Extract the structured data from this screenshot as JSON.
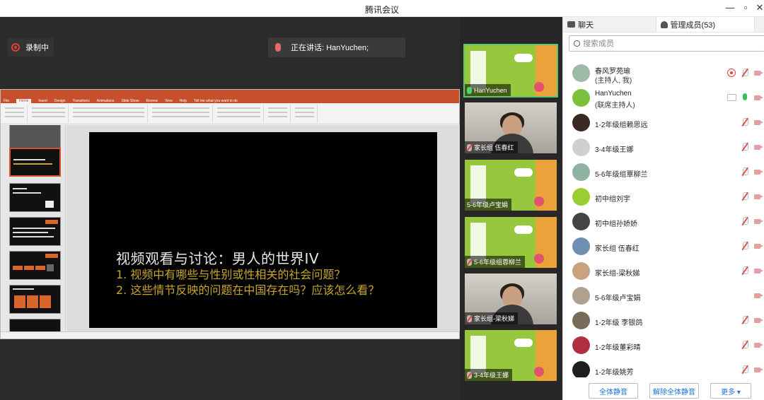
{
  "window": {
    "title": "腾讯会议",
    "controls": [
      "—",
      "▫",
      "✕"
    ]
  },
  "stage": {
    "recording_label": "录制中",
    "speaking_label": "正在讲话: HanYuchen;"
  },
  "slide": {
    "title": "视频观看与讨论：男人的世界IV",
    "lines": [
      "1. 视频中有哪些与性别或性相关的社会问题？",
      "2. 这些情节反映的问题在中国存在吗？应该怎么看？"
    ]
  },
  "ppt": {
    "tabs": [
      "File",
      "Home",
      "Insert",
      "Design",
      "Transitions",
      "Animations",
      "Slide Show",
      "Review",
      "View",
      "Help",
      "Tell me what you want to do"
    ],
    "share": "Share"
  },
  "tiles": [
    {
      "name": "HanYuchen",
      "type": "poster",
      "mic": "on",
      "active": true
    },
    {
      "name": "家长组 伍春红",
      "type": "cam",
      "mic": "off"
    },
    {
      "name": "5-6年级卢宝娟",
      "type": "poster",
      "mic": "none"
    },
    {
      "name": "5-6年级组蓉柳兰",
      "type": "poster",
      "mic": "off"
    },
    {
      "name": "家长组-梁秋娣",
      "type": "cam",
      "mic": "off"
    },
    {
      "name": "3-4年级王娜",
      "type": "poster",
      "mic": "off"
    }
  ],
  "panel": {
    "tab_chat": "聊天",
    "tab_members": "管理成员(53)",
    "search_placeholder": "搜索成员",
    "members": [
      {
        "name": "春风罗苑瑜",
        "sub": "(主持人, 我)",
        "color": "#9db9a8",
        "icons": [
          "rec",
          "micoff",
          "camoff"
        ]
      },
      {
        "name": "HanYuchen",
        "sub": "(联席主持人)",
        "color": "#7cbf3a",
        "icons": [
          "screen",
          "micon",
          "camoff"
        ]
      },
      {
        "name": "1-2年级组赖思远",
        "color": "#3a2a22",
        "icons": [
          "micoff",
          "camoff"
        ]
      },
      {
        "name": "3-4年级王娜",
        "color": "#cfcfcf",
        "icons": [
          "micoff",
          "camoff"
        ]
      },
      {
        "name": "5-6年级组覃柳兰",
        "color": "#8fb3a0",
        "icons": [
          "micoff",
          "camoff"
        ]
      },
      {
        "name": "初中组刘宇",
        "color": "#9acd32",
        "icons": [
          "micoff",
          "camoff"
        ]
      },
      {
        "name": "初中组孙娇娇",
        "color": "#444444",
        "icons": [
          "micoff",
          "camoff"
        ]
      },
      {
        "name": "家长组 伍春红",
        "color": "#6f8fb0",
        "icons": [
          "micoff",
          "camoff"
        ]
      },
      {
        "name": "家长组-梁秋娣",
        "color": "#c9a37d",
        "icons": [
          "micoff",
          "camoff"
        ]
      },
      {
        "name": "5-6年级卢宝娟",
        "color": "#b0a090",
        "icons": [
          "camoff"
        ]
      },
      {
        "name": "1-2年级 李银鸽",
        "color": "#7a6a58",
        "icons": [
          "micoff",
          "camoff"
        ]
      },
      {
        "name": "1-2年级董彩晴",
        "color": "#b03040",
        "icons": [
          "micoff",
          "camoff"
        ]
      },
      {
        "name": "1-2年级姚芳",
        "color": "#1e1e1e",
        "icons": [
          "micoff",
          "camoff"
        ]
      }
    ],
    "btn_mute_all": "全体静音",
    "btn_unmute_all": "解除全体静音",
    "btn_more": "更多 ▾"
  }
}
